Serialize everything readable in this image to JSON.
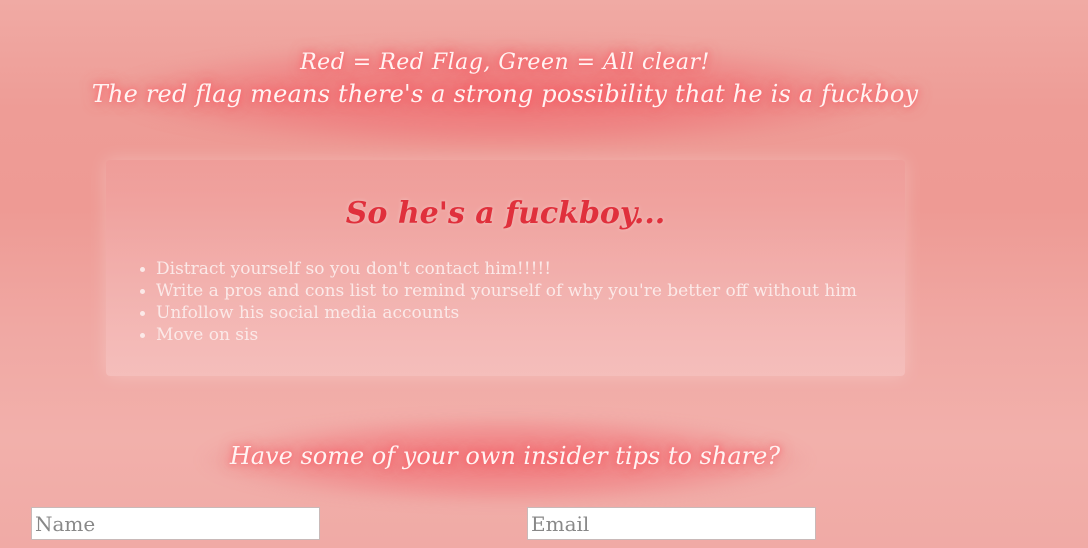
{
  "header": {
    "line1": "Red = Red Flag, Green = All clear!",
    "line2": "The red flag means there's a strong possibility that he is a fuckboy"
  },
  "card": {
    "title": "So he's a fuckboy...",
    "tips": [
      "Distract yourself so you don't contact him!!!!!",
      "Write a pros and cons list to remind yourself of why you're better off without him",
      "Unfollow his social media accounts",
      "Move on sis"
    ]
  },
  "share": {
    "prompt": "Have some of your own insider tips to share?"
  },
  "form": {
    "name_placeholder": "Name",
    "name_value": "",
    "email_placeholder": "Email",
    "email_value": ""
  },
  "colors": {
    "accent_red": "#e0303c",
    "background_pink": "#ee9c96",
    "text_light": "#fbe9e8"
  }
}
